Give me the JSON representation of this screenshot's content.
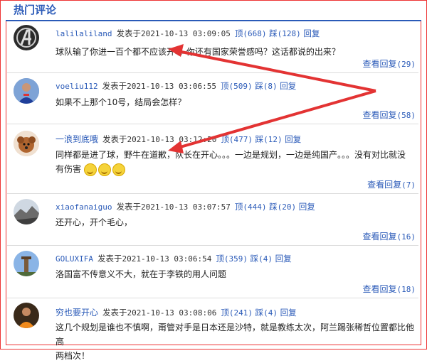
{
  "header": {
    "title": "热门评论"
  },
  "meta_labels": {
    "posted": "发表于",
    "up": "顶",
    "down": "踩",
    "reply": "回复",
    "view_replies": "查看回复"
  },
  "comments": [
    {
      "user": "lalilaliland",
      "time": "2021-10-13 03:09:05",
      "up": "(668)",
      "down": "(128)",
      "text": "球队输了你进一百个都不应该开心 你还有国家荣誉感吗？这话都说的出来？",
      "replies": "(29)"
    },
    {
      "user": "voeliu112",
      "time": "2021-10-13 03:06:55",
      "up": "(509)",
      "down": "(8)",
      "text": "如果不上那个10号，结局会怎样？",
      "replies": "(58)"
    },
    {
      "user": "一浪到底哦",
      "time": "2021-10-13 03:12:20",
      "up": "(477)",
      "down": "(12)",
      "text": "同样都是进了球，野牛在道歉，队长在开心。。。一边是规划，一边是纯国产。。。没有对比就没",
      "text2": "有伤害",
      "replies": "(7)"
    },
    {
      "user": "xiaofanaiguo",
      "time": "2021-10-13 03:07:57",
      "up": "(444)",
      "down": "(20)",
      "text": "还开心，开个毛心，",
      "replies": "(16)"
    },
    {
      "user": "GOLUXIFA",
      "time": "2021-10-13 03:06:54",
      "up": "(359)",
      "down": "(4)",
      "text": "洛国富不传意义不大，就在于李铁的用人问题",
      "replies": "(18)"
    },
    {
      "user": "穷也要开心",
      "time": "2021-10-13 03:08:06",
      "up": "(241)",
      "down": "(4)",
      "text": "这几个规划是谁也不慎啊，甭管对手是日本还是沙特，就是教练太次，阿兰踢张稀哲位置都比他高",
      "text2": "两档次！"
    }
  ],
  "colors": {
    "accent": "#2a5ab8",
    "annotation": "#e33333"
  },
  "icons": [
    "avatar-avengers",
    "avatar-player-blue",
    "avatar-dog",
    "avatar-landscape",
    "avatar-tower",
    "avatar-player-orange",
    "smile-emoji"
  ]
}
